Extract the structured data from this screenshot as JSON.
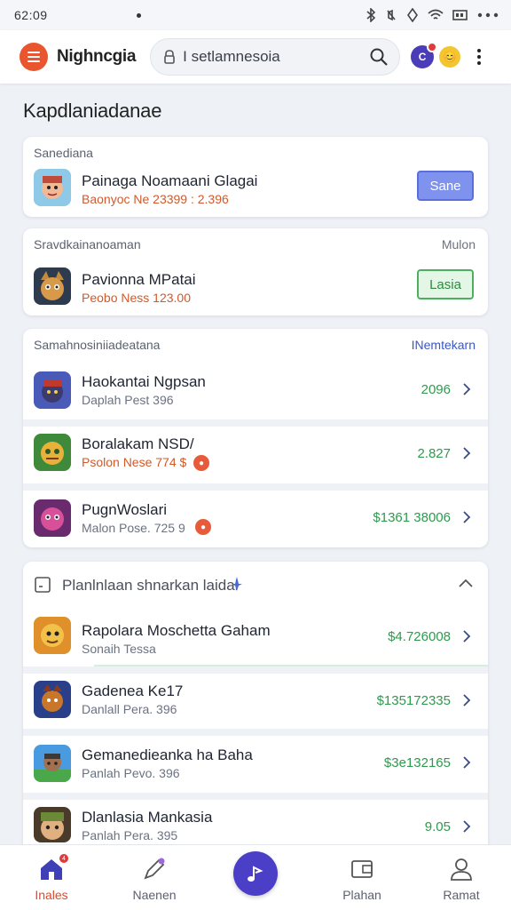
{
  "status": {
    "time": "62:09"
  },
  "app": {
    "title": "Nighncgia"
  },
  "search": {
    "text": "I setlamnesoia"
  },
  "page": {
    "title": "Kapdlaniadanae"
  },
  "sections": [
    {
      "header": "Sanediana",
      "header_right": "",
      "item": {
        "name": "Painaga Noamaani Glagai",
        "sub": "Baonyoc Ne 23399 : 2.396",
        "button": "Sane"
      }
    },
    {
      "header": "Sravdkainanoaman",
      "header_right": "Mulon",
      "item": {
        "name": "Pavionna MPatai",
        "sub": "Peobo Ness 123.00",
        "button": "Lasia"
      }
    },
    {
      "header": "Samahnosiniiadeatana",
      "header_right": "INemtekarn",
      "rows": [
        {
          "name": "Haokantai Ngpsan",
          "sub": "Daplah Pest 396",
          "price": "2096"
        },
        {
          "name": "Boralakam NSD/",
          "sub": "Psolon Nese 774 $",
          "price": "2.827"
        },
        {
          "name": "PugnWoslari",
          "sub": "Malon Pose. 725 9",
          "price": "$1361 38006"
        }
      ]
    },
    {
      "header": "Planlnlaan shnarkan laidai",
      "rows": [
        {
          "name": "Rapolara Moschetta Gaham",
          "sub": "Sonaih Tessa",
          "price": "$4.726008"
        },
        {
          "name": "Gadenea Ke17",
          "sub": "Danlall Pera. 396",
          "price": "$135172335"
        },
        {
          "name": "Gemanedieanka ha Baha",
          "sub": "Panlah Pevo. 396",
          "price": "$3e132165"
        },
        {
          "name": "Dlanlasia Mankasia",
          "sub": "Panlah Pera. 395",
          "price": "9.05"
        }
      ]
    }
  ],
  "nav": [
    {
      "label": "Inales",
      "icon": "home-icon",
      "badge": "4"
    },
    {
      "label": "Naenen",
      "icon": "pencil-icon"
    },
    {
      "label": "Plahan",
      "icon": "wallet-icon"
    },
    {
      "label": "Ramat",
      "icon": "person-icon"
    }
  ],
  "colors": {
    "accent": "#e9552f",
    "primary": "#4b3fc7",
    "price_green": "#2e9a4d",
    "sub_orange": "#d2592a"
  }
}
